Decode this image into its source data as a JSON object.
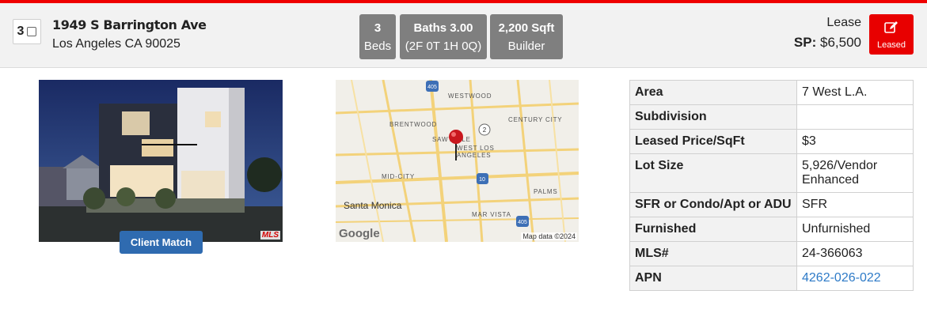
{
  "listing": {
    "index": "3",
    "street": "1949 S Barrington Ave",
    "city_line": "Los Angeles CA 90025"
  },
  "badges": {
    "beds_value": "3",
    "beds_label": "Beds",
    "baths_value": "Baths 3.00",
    "baths_detail": "(2F 0T 1H 0Q)",
    "sqft_value": "2,200 Sqft",
    "sqft_source": "Builder"
  },
  "status": {
    "type": "Lease",
    "sp_label": "SP:",
    "sp_value": "$6,500",
    "button_label": "Leased",
    "button_color": "#e80000"
  },
  "photo": {
    "mls_mark": "MLS",
    "client_match_label": "Client Match",
    "client_match_color": "#2f6bb0"
  },
  "map": {
    "labels": [
      "WESTWOOD",
      "BRENTWOOD",
      "CENTURY CITY",
      "SAWTELLE",
      "WEST LOS ANGELES",
      "MID-CITY",
      "PALMS",
      "MAR VISTA"
    ],
    "city": "Santa Monica",
    "shields": [
      "405",
      "2",
      "10",
      "405"
    ],
    "logo": "Google",
    "attribution": "Map data ©2024"
  },
  "details": {
    "rows": [
      {
        "label": "Area",
        "value": "7 West L.A."
      },
      {
        "label": "Subdivision",
        "value": ""
      },
      {
        "label": "Leased Price/SqFt",
        "value": "$3"
      },
      {
        "label": "Lot Size",
        "value": "5,926/Vendor Enhanced"
      },
      {
        "label": "SFR or Condo/Apt or ADU",
        "value": "SFR"
      },
      {
        "label": "Furnished",
        "value": "Unfurnished"
      },
      {
        "label": "MLS#",
        "value": "24-366063"
      },
      {
        "label": "APN",
        "value": "4262-026-022"
      }
    ]
  },
  "colors": {
    "top_bar": "#ef0000",
    "badge_bg": "#7f7f7f",
    "link": "#2d7ac7"
  }
}
